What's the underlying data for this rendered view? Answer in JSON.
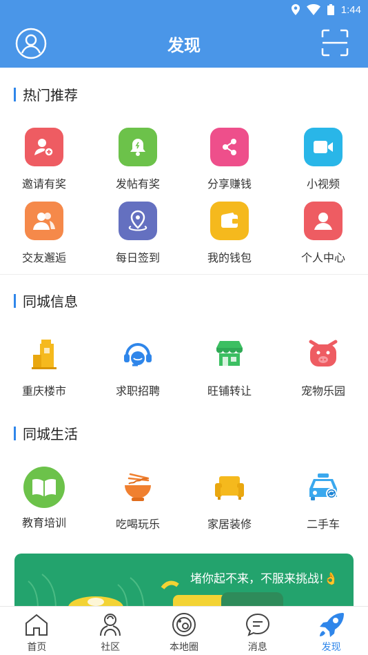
{
  "status_bar": {
    "time": "1:44",
    "icons": [
      "location-icon",
      "wifi-icon",
      "battery-icon"
    ]
  },
  "header": {
    "title": "发现",
    "left_icon": "user-circle-icon",
    "right_icon": "scan-icon"
  },
  "sections": [
    {
      "title": "热门推荐",
      "items": [
        {
          "label": "邀请有奖",
          "icon": "invite-user-icon",
          "color": "#ee5c62"
        },
        {
          "label": "发帖有奖",
          "icon": "bell-icon",
          "color": "#6cc24a"
        },
        {
          "label": "分享赚钱",
          "icon": "share-icon",
          "color": "#ee4f8b"
        },
        {
          "label": "小视频",
          "icon": "video-icon",
          "color": "#29b6e8"
        },
        {
          "label": "交友邂逅",
          "icon": "friends-icon",
          "color": "#f5894a"
        },
        {
          "label": "每日签到",
          "icon": "location-pin-icon",
          "color": "#6470c0"
        },
        {
          "label": "我的钱包",
          "icon": "wallet-icon",
          "color": "#f5b91d"
        },
        {
          "label": "个人中心",
          "icon": "person-icon",
          "color": "#ee5c62"
        }
      ]
    },
    {
      "title": "同城信息",
      "items": [
        {
          "label": "重庆楼市",
          "icon": "building-icon",
          "color": "#f5b91d"
        },
        {
          "label": "求职招聘",
          "icon": "headset-icon",
          "color": "#2f86ea"
        },
        {
          "label": "旺铺转让",
          "icon": "shop-icon",
          "color": "#3cbf62"
        },
        {
          "label": "宠物乐园",
          "icon": "pig-icon",
          "color": "#ee5c62"
        }
      ]
    },
    {
      "title": "同城生活",
      "items": [
        {
          "label": "教育培训",
          "icon": "book-icon",
          "color": "#6cc24a"
        },
        {
          "label": "吃喝玩乐",
          "icon": "noodle-bowl-icon",
          "color": "#f08030"
        },
        {
          "label": "家居装修",
          "icon": "sofa-icon",
          "color": "#f5b91d"
        },
        {
          "label": "二手车",
          "icon": "car-icon",
          "color": "#3aa8ee"
        }
      ]
    }
  ],
  "banner": {
    "text": "堵你起不来，不服来挑战!👌"
  },
  "bottom_nav": [
    {
      "label": "首页",
      "icon": "home-icon",
      "active": false
    },
    {
      "label": "社区",
      "icon": "community-icon",
      "active": false
    },
    {
      "label": "本地圈",
      "icon": "local-circle-icon",
      "active": false
    },
    {
      "label": "消息",
      "icon": "message-icon",
      "active": false
    },
    {
      "label": "发现",
      "icon": "discover-rocket-icon",
      "active": true
    }
  ],
  "colors": {
    "primary": "#4a96e8",
    "accent": "#2f86ea",
    "banner": "#23a36d"
  }
}
